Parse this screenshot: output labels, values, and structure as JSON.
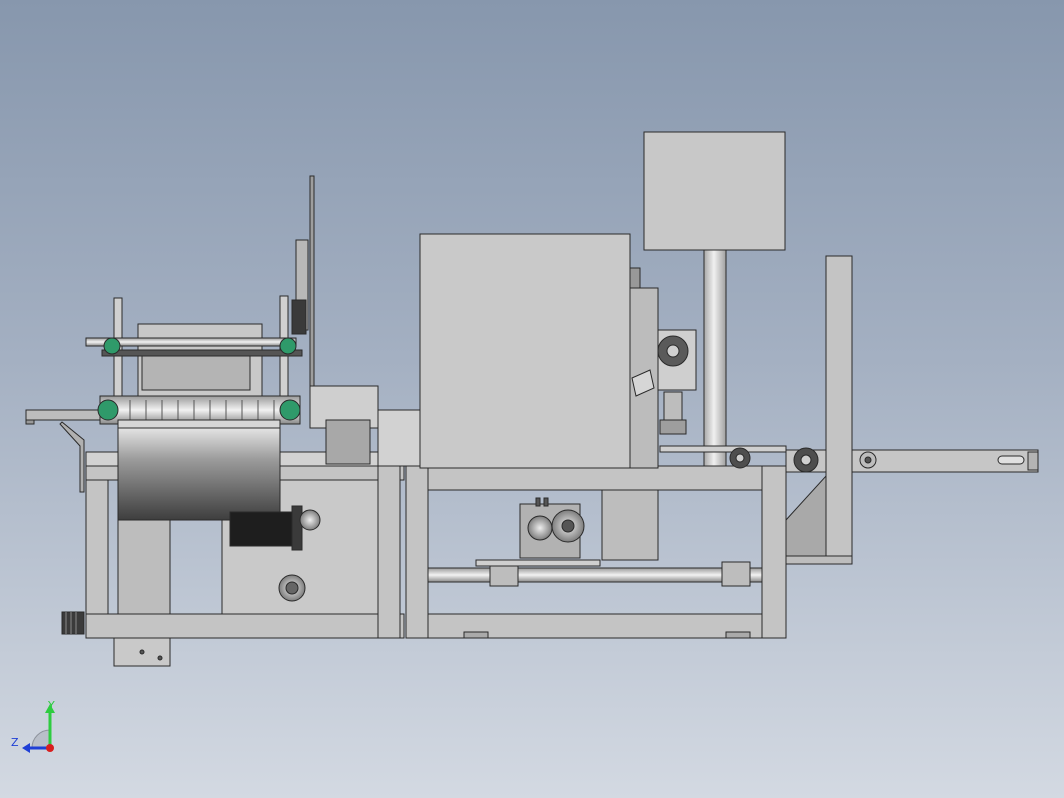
{
  "viewport": {
    "background_top": "#8797ad",
    "background_bottom": "#d3d9e2"
  },
  "colors": {
    "part_fill": "#c4c4c4",
    "part_light": "#d9d9d9",
    "part_dark": "#9a9a9a",
    "edge": "#2a2a2a",
    "accent_green": "#2f9a6a",
    "motor_black": "#1e1e1e"
  },
  "triad": {
    "y_label": "Y",
    "z_label": "Z",
    "y_color": "#2ecc40",
    "z_color": "#1f3fd6",
    "x_color": "#d81e1e"
  }
}
